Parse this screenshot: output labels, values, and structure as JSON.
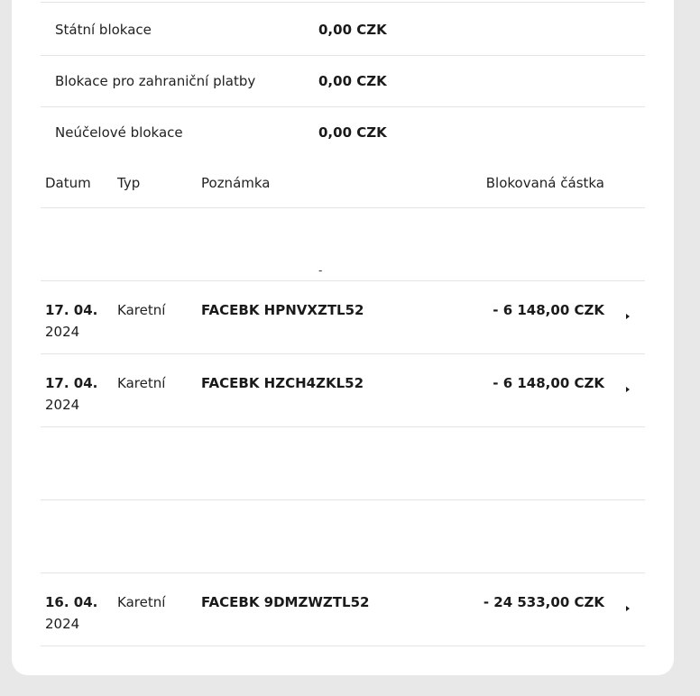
{
  "summary": [
    {
      "label": "Státní blokace",
      "value": "0,00 CZK"
    },
    {
      "label": "Blokace pro zahraniční platby",
      "value": "0,00 CZK"
    },
    {
      "label": "Neúčelové blokace",
      "value": "0,00 CZK"
    }
  ],
  "table": {
    "headers": {
      "date": "Datum",
      "type": "Typ",
      "note": "Poznámka",
      "amount": "Blokovaná částka"
    },
    "placeholder": "-",
    "rows": [
      {
        "date": "17. 04.",
        "year": "2024",
        "type": "Karetní",
        "note": "FACEBK HPNVXZTL52",
        "amount": "- 6 148,00 CZK"
      },
      {
        "date": "17. 04.",
        "year": "2024",
        "type": "Karetní",
        "note": "FACEBK HZCH4ZKL52",
        "amount": "- 6 148,00 CZK"
      },
      {
        "date": "16. 04.",
        "year": "2024",
        "type": "Karetní",
        "note": "FACEBK 9DMZWZTL52",
        "amount": "- 24 533,00 CZK"
      }
    ]
  }
}
